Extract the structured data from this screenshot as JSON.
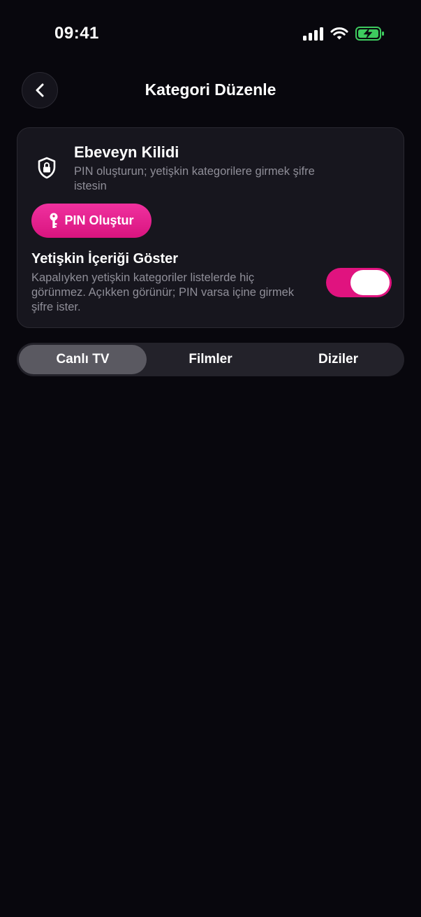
{
  "status_bar": {
    "time": "09:41",
    "icons": [
      "cellular-signal-icon",
      "wifi-icon",
      "battery-charging-icon"
    ]
  },
  "header": {
    "title": "Kategori Düzenle",
    "back_icon": "chevron-left-icon"
  },
  "parental_lock": {
    "icon": "shield-lock-icon",
    "title": "Ebeveyn Kilidi",
    "description": "PIN oluşturun; yetişkin kategorilere girmek şifre istesin",
    "pin_button": {
      "icon": "key-icon",
      "label": "PIN Oluştur"
    }
  },
  "adult_content": {
    "title": "Yetişkin İçeriği Göster",
    "description": "Kapalıyken yetişkin kategoriler listelerde hiç görünmez. Açıkken görünür; PIN varsa içine girmek şifre ister.",
    "enabled": true
  },
  "tabs": [
    {
      "label": "Canlı TV",
      "active": true
    },
    {
      "label": "Filmler",
      "active": false
    },
    {
      "label": "Diziler",
      "active": false
    }
  ],
  "colors": {
    "background": "#08070d",
    "card": "#17161e",
    "accent": "#e0137f",
    "muted_text": "#8f8e98",
    "battery": "#3ecb5f"
  }
}
